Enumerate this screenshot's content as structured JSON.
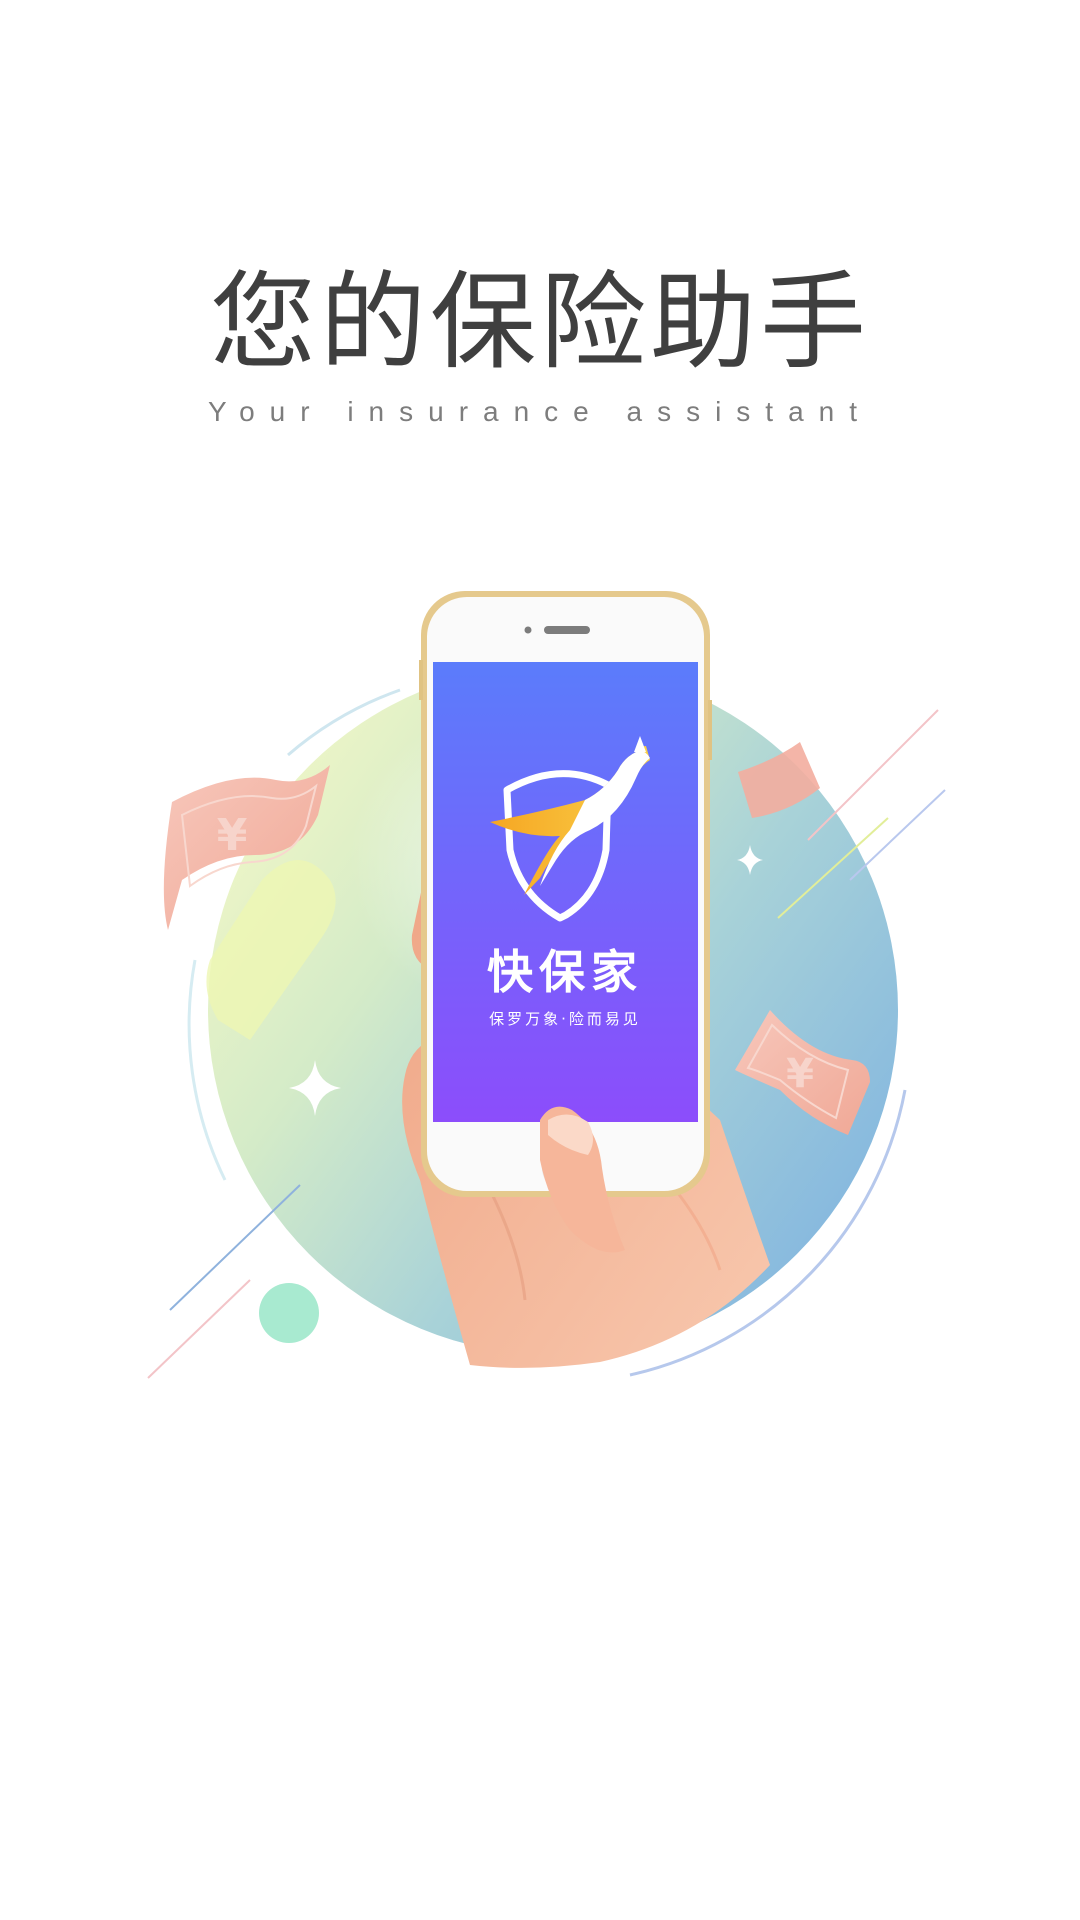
{
  "splash": {
    "title": "您的保险助手",
    "subtitle": "Your insurance assistant"
  },
  "app": {
    "name": "快保家",
    "slogan": "保罗万象·险而易见",
    "gradient_top": "#5b7cfb",
    "gradient_bottom": "#8a4cfb"
  },
  "decor": {
    "money_symbol": "¥",
    "bill_color": "#f4b9ad",
    "circle_left_color": "#eef6c4",
    "circle_right_color": "#7fb6e2",
    "phone_frame_color": "#e5c98d",
    "skin_color": "#f2b497",
    "dot_color": "#a8ead0"
  }
}
